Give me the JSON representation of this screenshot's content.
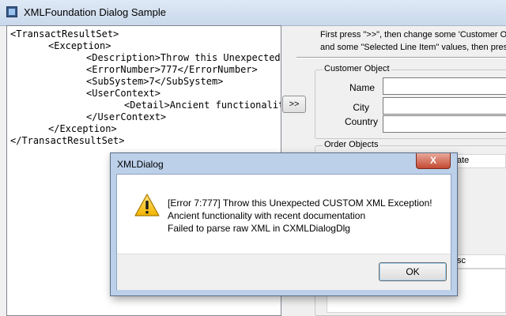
{
  "window": {
    "title": "XMLFoundation Dialog Sample"
  },
  "xml_lines": [
    "<TransactResultSet>",
    "<Exception>",
    "<Description>Throw this Unexpected C",
    "<ErrorNumber>777</ErrorNumber>",
    "<SubSystem>7</SubSystem>",
    "<UserContext>",
    "<Detail>Ancient functionality",
    "</UserContext>",
    "</Exception>",
    "</TransactResultSet>"
  ],
  "arrow_button": ">>",
  "instructions": {
    "line1": "First press \">>\", then change some  'Customer Ob",
    "line2": "and some \"Selected Line Item\" values, then press"
  },
  "customer": {
    "group_label": "Customer Object",
    "name_label": "Name",
    "city_label": "City",
    "country_label": "Country"
  },
  "orders": {
    "group_label": "Order Objects",
    "col_date": "ate",
    "col_desc": "sc"
  },
  "dialog": {
    "title": "XMLDialog",
    "close": "X",
    "line1": "[Error 7:777] Throw this Unexpected CUSTOM XML Exception!",
    "line2": "Ancient functionality with recent documentation",
    "line3": "Failed to parse raw XML in CXMLDialogDlg",
    "ok": "OK"
  }
}
